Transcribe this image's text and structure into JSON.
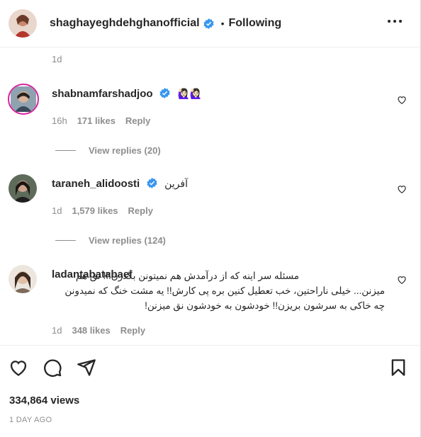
{
  "post": {
    "username": "shaghayeghdehghanofficial",
    "separator": "•",
    "follow_state": "Following",
    "first_comment_time": "1d"
  },
  "comments": [
    {
      "username": "shabnamfarshadjoo",
      "text": "🙋🏻‍♀️🙋🏻‍♀️",
      "time": "16h",
      "likes": "171 likes",
      "reply": "Reply",
      "view_replies": "View replies (20)"
    },
    {
      "username": "taraneh_alidoosti",
      "text": "آفرین",
      "time": "1d",
      "likes": "1,579 likes",
      "reply": "Reply",
      "view_replies": "View replies (124)"
    },
    {
      "username": "ladantabatabaei",
      "text": "مسئله سر اینه که از درآمدش هم نمیتونن بگذرن!!! نق هم میزنن... خیلی ناراحتین، خب تعطیل کنین بره پی کارش!! یه مشت خنگ که نمیدونن چه خاکی به سرشون بریزن!! خودشون به خودشون نق میزنن!",
      "time": "1d",
      "likes": "348 likes",
      "reply": "Reply"
    }
  ],
  "stats": {
    "views": "334,864 views",
    "date": "1 DAY AGO"
  },
  "colors": {
    "verified": "#3897f0",
    "muted": "#8e8e8e",
    "text": "#262626"
  }
}
